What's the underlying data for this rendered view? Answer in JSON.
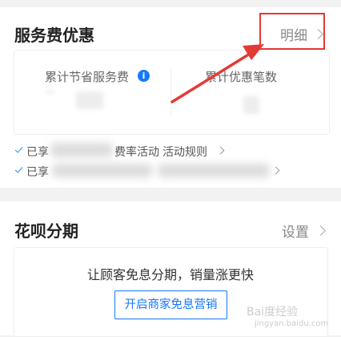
{
  "service_fee": {
    "title": "服务费优惠",
    "detail_link": "明细",
    "stats": [
      {
        "label": "累计节省服务费",
        "icon": "info-icon"
      },
      {
        "label": "累计优惠笔数"
      }
    ],
    "bullets": [
      {
        "prefix": "已享",
        "middle": "费率活动",
        "link": "活动规则"
      },
      {
        "prefix": "已享",
        "middle": "",
        "link": ""
      }
    ]
  },
  "huabei": {
    "title": "花呗分期",
    "settings_link": "设置",
    "promo_text": "让顾客免息分期，销量涨更快",
    "promo_button": "开启商家免息营销"
  },
  "watermark": {
    "text": "Bai度经验",
    "sub": "jingyan.baidu.com"
  },
  "annotation_color": "#e53935",
  "accent_color": "#1677ff"
}
